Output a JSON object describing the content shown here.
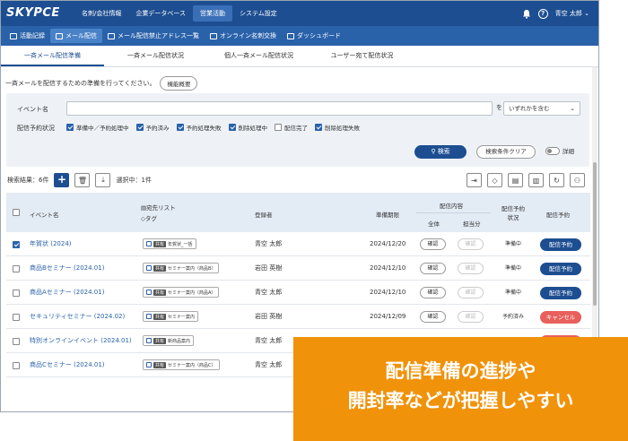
{
  "app": {
    "logo": "SKYPCE",
    "top_nav": [
      "名刺/会社情報",
      "企業データベース",
      "営業活動",
      "システム設定"
    ],
    "top_nav_active": 2,
    "user_name": "青空 太郎"
  },
  "sub_nav": [
    "活動記録",
    "メール配信",
    "メール配信禁止アドレス一覧",
    "オンライン名刺交換",
    "ダッシュボード"
  ],
  "tabs": [
    "一斉メール配信準備",
    "一斉メール配信状況",
    "個人一斉メール配信状況",
    "ユーザー宛て配信状況"
  ],
  "info": {
    "text": "一斉メールを配信するための準備を行ってください。",
    "button": "機能概要"
  },
  "search": {
    "event_label": "イベント名",
    "event_value": "",
    "wo": "を",
    "match_select": "いずれかを含む",
    "status_label": "配信予約状況",
    "statuses": [
      {
        "label": "準備中／予約処理中",
        "checked": true
      },
      {
        "label": "予約済み",
        "checked": true
      },
      {
        "label": "予約処理失敗",
        "checked": true
      },
      {
        "label": "削除処理中",
        "checked": true
      },
      {
        "label": "配信完了",
        "checked": false
      },
      {
        "label": "削除処理失敗",
        "checked": true
      }
    ],
    "search_button": "検索",
    "clear_button": "検索条件クリア",
    "detail_toggle": "詳細"
  },
  "results": {
    "count_text": "検索結果：6件",
    "selected_text": "選択中：1件"
  },
  "table": {
    "headers": {
      "event": "イベント名",
      "list": "宛先リスト",
      "tag": "タグ",
      "registrant": "登録者",
      "deadline": "準備期限",
      "content": "配信内容",
      "all": "全体",
      "assigned": "担当分",
      "status": "配信予約状況",
      "reserve": "配信予約"
    },
    "rows": [
      {
        "checked": true,
        "event": "年賀状 (2024)",
        "tag_type": "共有",
        "list": "年賀状_一括",
        "registrant": "青空 太郎",
        "deadline": "2024/12/20",
        "all": "確認",
        "assigned": "確認",
        "status": "準備中",
        "action": "配信予約",
        "action_color": "blue"
      },
      {
        "checked": false,
        "event": "商品Bセミナー (2024.01)",
        "tag_type": "共有",
        "list": "セミナー案内（商品B）",
        "registrant": "岩田 英樹",
        "deadline": "2024/12/10",
        "all": "確認",
        "assigned": "確認",
        "status": "準備中",
        "action": "配信予約",
        "action_color": "blue"
      },
      {
        "checked": false,
        "event": "商品Aセミナー (2024.01)",
        "tag_type": "共有",
        "list": "セミナー案内（商品A）",
        "registrant": "青空 太郎",
        "deadline": "2024/12/10",
        "all": "確認",
        "assigned": "確認",
        "status": "準備中",
        "action": "配信予約",
        "action_color": "blue"
      },
      {
        "checked": false,
        "event": "セキュリティセミナー (2024.02)",
        "tag_type": "共有",
        "list": "セミナー案内",
        "registrant": "岩田 英樹",
        "deadline": "2024/12/09",
        "all": "確認",
        "assigned": "確認",
        "status": "予約済み",
        "action": "キャンセル",
        "action_color": "red"
      },
      {
        "checked": false,
        "event": "特別オンラインイベント (2024.01)",
        "tag_type": "共有",
        "list": "新商品案内",
        "registrant": "青空 太郎",
        "deadline": "",
        "all": "",
        "assigned": "",
        "status": "",
        "action": "",
        "action_color": "red"
      },
      {
        "checked": false,
        "event": "商品Cセミナー (2024.01)",
        "tag_type": "共有",
        "list": "セミナー案内（商品C）",
        "registrant": "青空 太郎",
        "deadline": "",
        "all": "",
        "assigned": "",
        "status": "",
        "action": "",
        "action_color": ""
      }
    ]
  },
  "overlay": {
    "line1": "配信準備の進捗や",
    "line2": "開封率などが把握しやすい"
  },
  "colors": {
    "navy": "#1d4e91",
    "orange": "#f0920a",
    "red": "#e8605c"
  }
}
